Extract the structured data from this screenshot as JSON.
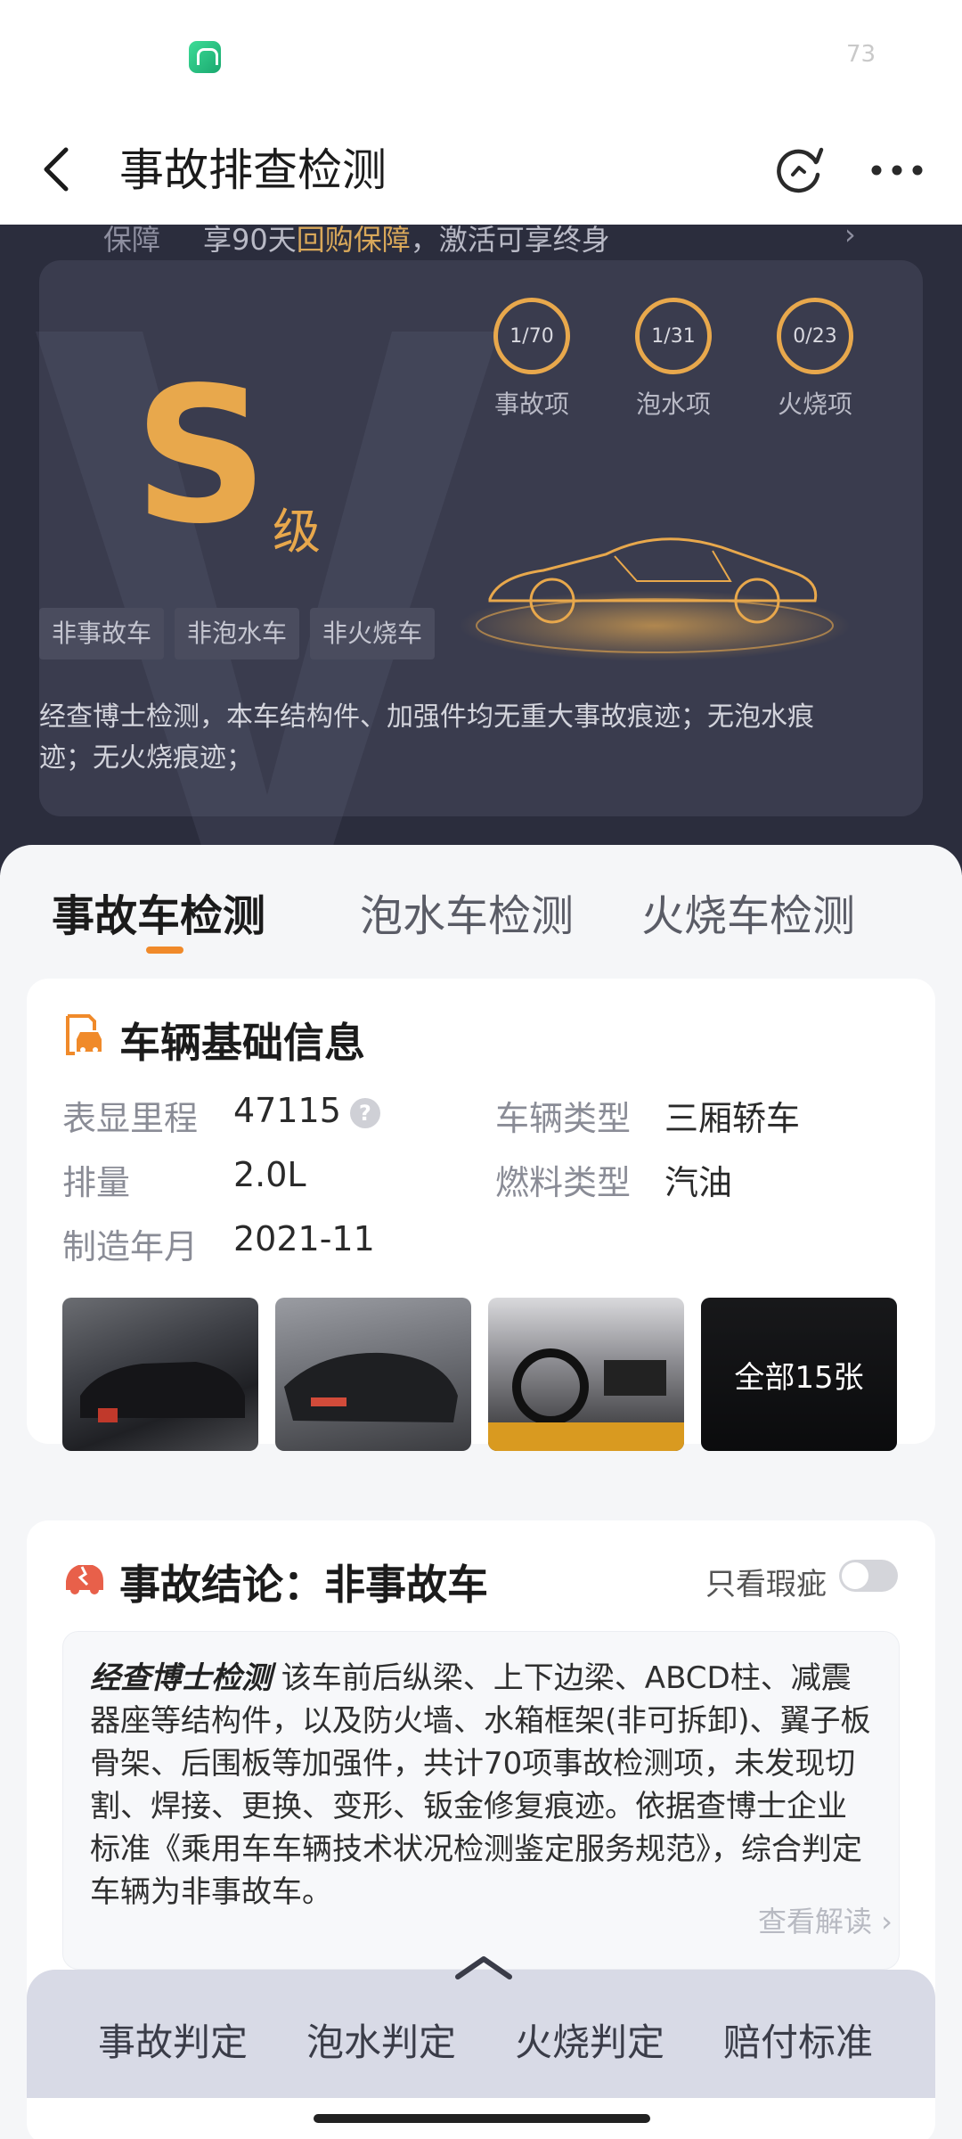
{
  "status_bar": {
    "battery": "73"
  },
  "nav": {
    "title": "事故排查检测"
  },
  "hero": {
    "guarantee_label": "保障",
    "guarantee_text_pre": "享90天",
    "guarantee_text_highlight": "回购保障",
    "guarantee_text_post": "，激活可享终身",
    "grade": "S",
    "grade_suffix": "级",
    "checks": [
      {
        "value": "1/70",
        "label": "事故项"
      },
      {
        "value": "1/31",
        "label": "泡水项"
      },
      {
        "value": "0/23",
        "label": "火烧项"
      }
    ],
    "tags": [
      "非事故车",
      "非泡水车",
      "非火烧车"
    ],
    "description": "经查博士检测，本车结构件、加强件均无重大事故痕迹；无泡水痕迹；无火烧痕迹；"
  },
  "tabs": [
    {
      "label": "事故车检测",
      "active": true
    },
    {
      "label": "泡水车检测",
      "active": false
    },
    {
      "label": "火烧车检测",
      "active": false
    }
  ],
  "basic_info": {
    "title": "车辆基础信息",
    "fields": {
      "mileage_k": "表显里程",
      "mileage_v": "47115",
      "type_k": "车辆类型",
      "type_v": "三厢轿车",
      "disp_k": "排量",
      "disp_v": "2.0L",
      "fuel_k": "燃料类型",
      "fuel_v": "汽油",
      "date_k": "制造年月",
      "date_v": "2021-11"
    },
    "photos_all_label": "全部15张"
  },
  "conclusion": {
    "title": "事故结论：非事故车",
    "toggle_label": "只看瑕疵",
    "brand": "经查博士检测",
    "text": " 该车前后纵梁、上下边梁、ABCD柱、减震器座等结构件，以及防火墙、水箱框架(非可拆卸)、翼子板骨架、后围板等加强件，共计70项事故检测项，未发现切割、焊接、更换、变形、钣金修复痕迹。依据查博士企业标准《乘用车车辆技术状况检测鉴定服务规范》，综合判定车辆为非事故车。",
    "more": "查看解读 ›"
  },
  "bottom_bar": [
    "事故判定",
    "泡水判定",
    "火烧判定",
    "赔付标准"
  ],
  "colors": {
    "accent": "#e8a84c",
    "tab_underline": "#f08a2a",
    "hero_bg": "#2b2d3d"
  }
}
